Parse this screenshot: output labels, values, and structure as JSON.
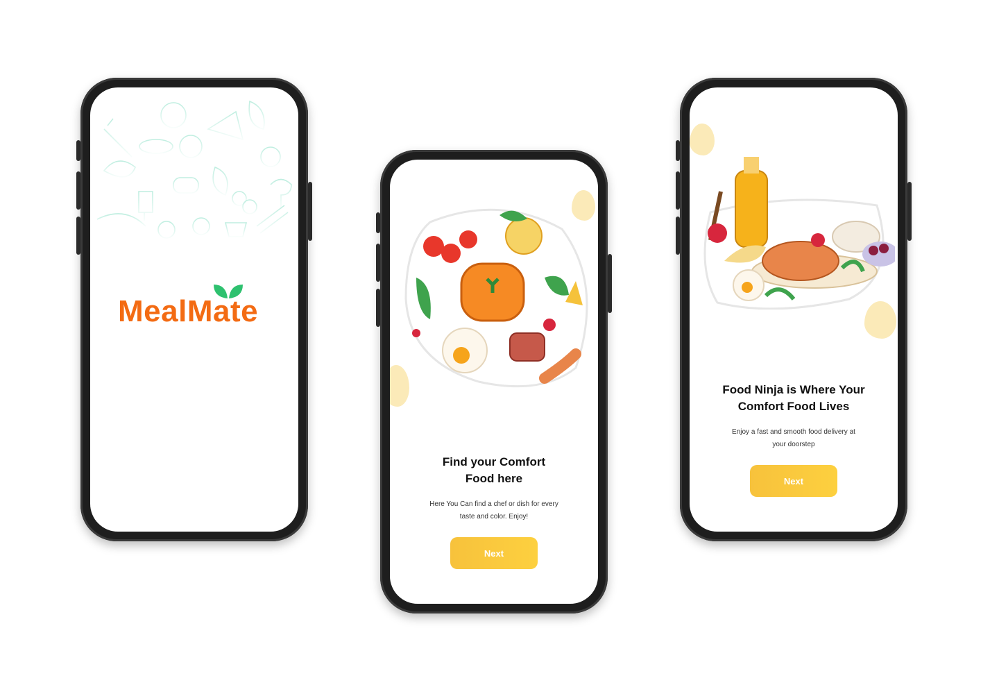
{
  "splash": {
    "logo_text": "MealMate",
    "logo_color": "#f36b13",
    "leaf_color": "#2ec16f"
  },
  "onboarding1": {
    "title_line1": "Find your Comfort",
    "title_line2": "Food here",
    "desc_line1": "Here You Can find a chef or dish for every",
    "desc_line2": "taste and color. Enjoy!",
    "button_label": "Next"
  },
  "onboarding2": {
    "title_line1": "Food Ninja is Where Your",
    "title_line2": "Comfort Food Lives",
    "desc_line1": "Enjoy a fast and smooth food delivery at",
    "desc_line2": "your doorstep",
    "button_label": "Next"
  },
  "colors": {
    "button": "#f9c83d",
    "accent_blob": "#fbeab8",
    "pattern": "#bfeee0"
  }
}
